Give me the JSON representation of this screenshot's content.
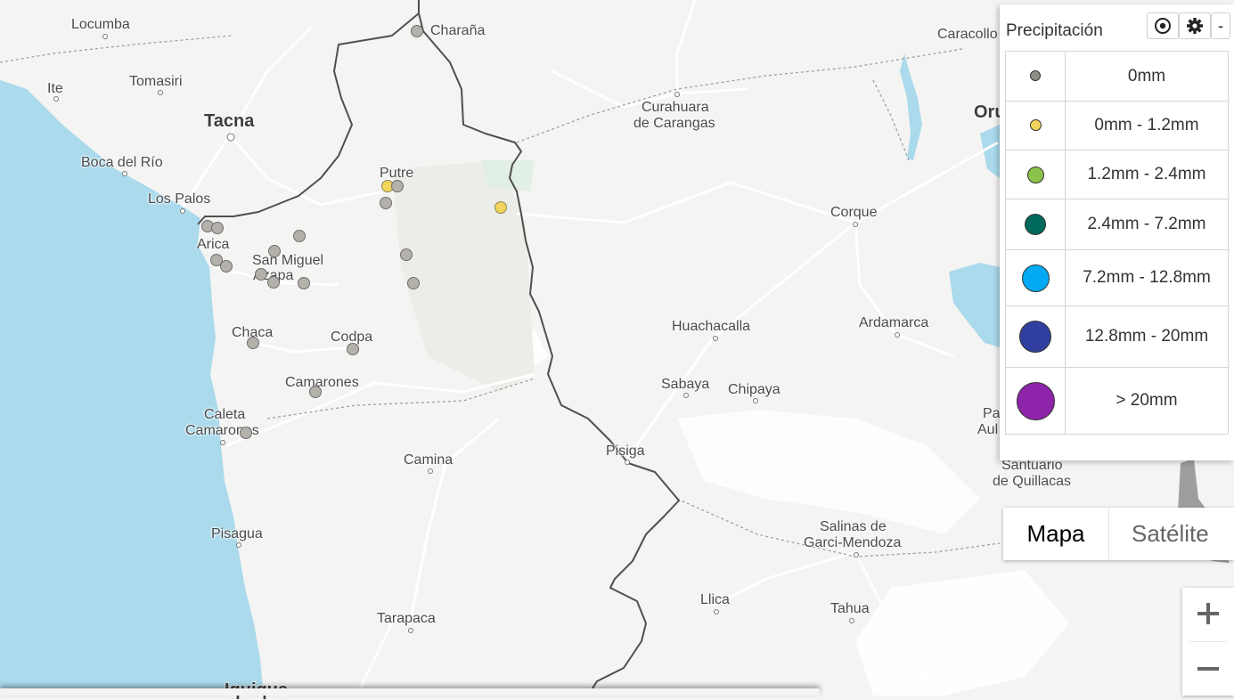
{
  "places": [
    {
      "id": "locumba",
      "name": "Locumba",
      "size": "normal"
    },
    {
      "id": "ite",
      "name": "Ite",
      "size": "normal"
    },
    {
      "id": "tomasiri",
      "name": "Tomasiri",
      "size": "normal"
    },
    {
      "id": "tacna",
      "name": "Tacna",
      "size": "big"
    },
    {
      "id": "boca-del-rio",
      "name": "Boca del Río",
      "size": "normal"
    },
    {
      "id": "los-palos",
      "name": "Los Palos",
      "size": "normal"
    },
    {
      "id": "arica",
      "name": "Arica",
      "size": "normal"
    },
    {
      "id": "san-miguel",
      "name": "San Miguel",
      "size": "normal"
    },
    {
      "id": "azapa",
      "name": "Azapa",
      "size": "normal"
    },
    {
      "id": "chaca",
      "name": "Chaca",
      "size": "normal"
    },
    {
      "id": "codpa",
      "name": "Codpa",
      "size": "normal"
    },
    {
      "id": "camarones",
      "name": "Camarones",
      "size": "normal"
    },
    {
      "id": "caleta",
      "name": "Caleta",
      "size": "normal"
    },
    {
      "id": "caleta-camarones",
      "name": "Camarones",
      "size": "normal"
    },
    {
      "id": "pisagua",
      "name": "Pisagua",
      "size": "normal"
    },
    {
      "id": "camina",
      "name": "Camina",
      "size": "normal"
    },
    {
      "id": "tarapaca",
      "name": "Tarapaca",
      "size": "normal"
    },
    {
      "id": "iquique",
      "name": "Iquique",
      "size": "big"
    },
    {
      "id": "putre",
      "name": "Putre",
      "size": "normal"
    },
    {
      "id": "charana",
      "name": "Charaña",
      "size": "normal"
    },
    {
      "id": "curahuara",
      "name": "Curahuara",
      "size": "normal"
    },
    {
      "id": "de-carangas",
      "name": "de Carangas",
      "size": "normal"
    },
    {
      "id": "caracollo",
      "name": "Caracollo",
      "size": "normal"
    },
    {
      "id": "oruro",
      "name": "Oru",
      "size": "big"
    },
    {
      "id": "corque",
      "name": "Corque",
      "size": "normal"
    },
    {
      "id": "huachacalla",
      "name": "Huachacalla",
      "size": "normal"
    },
    {
      "id": "ardamarca",
      "name": "Ardamarca",
      "size": "normal"
    },
    {
      "id": "sabaya",
      "name": "Sabaya",
      "size": "normal"
    },
    {
      "id": "chipaya",
      "name": "Chipaya",
      "size": "normal"
    },
    {
      "id": "pisiga",
      "name": "Pisiga",
      "size": "normal"
    },
    {
      "id": "pa",
      "name": "Pa",
      "size": "normal"
    },
    {
      "id": "aul",
      "name": "Aul",
      "size": "normal"
    },
    {
      "id": "santuario",
      "name": "Santuario",
      "size": "normal"
    },
    {
      "id": "de-quillacas",
      "name": "de Quillacas",
      "size": "normal"
    },
    {
      "id": "salinas-de",
      "name": "Salinas de",
      "size": "normal"
    },
    {
      "id": "garci-mendoza",
      "name": "Garci-Mendoza",
      "size": "normal"
    },
    {
      "id": "llica",
      "name": "Llica",
      "size": "normal"
    },
    {
      "id": "tahua",
      "name": "Tahua",
      "size": "normal"
    }
  ],
  "stations_count_note": "",
  "legend": {
    "title": "Precipitación",
    "locate_icon": "target-icon",
    "settings_icon": "gear-icon",
    "collapse_label": "-",
    "rows": [
      {
        "label": "0mm",
        "color": "#8f8f86"
      },
      {
        "label": "0mm - 1.2mm",
        "color": "#f2d35b"
      },
      {
        "label": "1.2mm - 2.4mm",
        "color": "#8bc34a"
      },
      {
        "label": "2.4mm - 7.2mm",
        "color": "#00695c"
      },
      {
        "label": "7.2mm - 12.8mm",
        "color": "#03a9f4"
      },
      {
        "label": "12.8mm - 20mm",
        "color": "#303f9f"
      },
      {
        "label": "> 20mm",
        "color": "#8e24aa"
      }
    ]
  },
  "map_type": {
    "map_label": "Mapa",
    "satellite_label": "Satélite",
    "selected": "Mapa"
  },
  "zoom": {
    "in_icon": "plus-icon",
    "out_icon": "minus-icon"
  },
  "colors": {
    "water": "#aadaec",
    "land": "#f4f4f3",
    "border": "#4f4f4f",
    "road": "#ffffff"
  }
}
